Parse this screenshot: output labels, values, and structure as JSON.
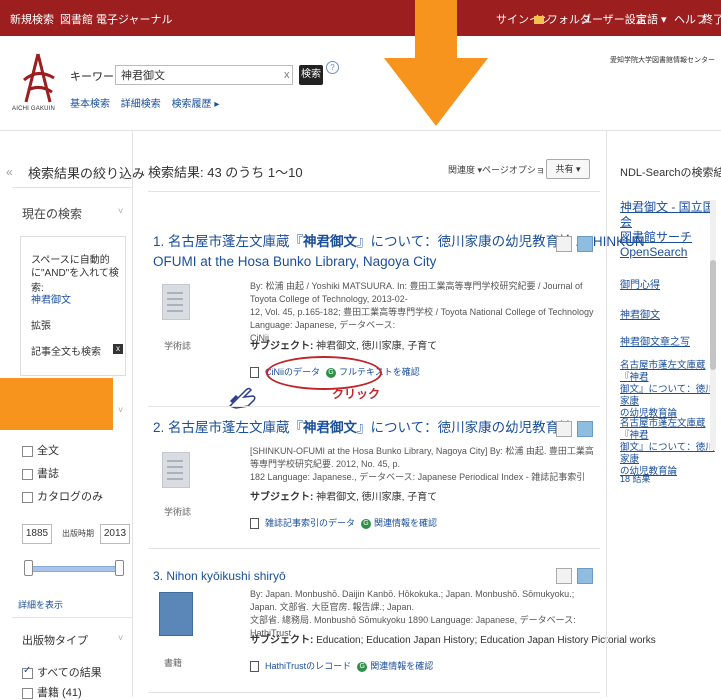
{
  "topbar": {
    "nav": [
      "新規検索",
      "図書館",
      "電子ジャーナル"
    ],
    "right": [
      "サインイン",
      "フォルダ",
      "ユーザー設定",
      "言語 ▾",
      "ヘルプ",
      "終了"
    ]
  },
  "header": {
    "logo_text": "AICHI GAKUIN",
    "search_type": "キーワード ▾",
    "search_value": "神君御文",
    "search_button": "検索",
    "help": "?",
    "sublinks": [
      "基本検索",
      "詳細検索",
      "検索履歴 ▸"
    ],
    "institution": "愛知学院大学図書館情報センター"
  },
  "sidebar": {
    "filter_title": "検索結果の絞り込み",
    "current_search": "現在の検索",
    "box": {
      "hint_line1": "スペースに自動的",
      "hint_line2": "に\"AND\"を入れて検索:",
      "term": "神君御文",
      "expand": "拡張",
      "fulltext_search": "記事全文も検索",
      "remove": "x"
    },
    "checkboxes": [
      "全文",
      "書誌",
      "カタログのみ"
    ],
    "year_from": "1885",
    "year_label": "出版時期",
    "year_to": "2013",
    "show_detail": "詳細を表示",
    "pub_type": "出版物タイプ",
    "pub_types": [
      "すべての結果",
      "書籍 (41)"
    ]
  },
  "results": {
    "count": "検索結果: 43 のうち 1〜10",
    "sort": "関連度 ▾",
    "page_options": "ページオプション ▾",
    "share": "共有 ▾",
    "items": [
      {
        "num_title_1": "1. 名古屋市蓬左文庫蔵『",
        "bold": "神君御文",
        "num_title_2": "』について：徳川家康の幼児教育論 / SHINKUN-",
        "title_line2": "OFUMI at the Hosa Bunko Library, Nagoya City",
        "meta_1": "By: 松浦 由起 / Yoshiki MATSUURA. In: 豊田工業高等専門学校研究紀要 / Journal of Toyota College of Technology, 2013-02-",
        "meta_2": "12, Vol. 45, p.165-182; 豊田工業高等専門学校 / Toyota National College of Technology Language: Japanese, データベース:",
        "meta_3": "CiNii",
        "type": "学術誌",
        "subject_label": "サブジェクト:",
        "subject": "神君御文, 徳川家康, 子育て",
        "link1": "CiNiiのデータ",
        "link2": "フルテキストを確認"
      },
      {
        "num_title_1": "2. 名古屋市蓬左文庫蔵『",
        "bold": "神君御文",
        "num_title_2": "』について：徳川家康の幼児教育論",
        "meta_1": "[SHINKUN-OFUMI at the Hosa Bunko Library, Nagoya City] By: 松浦 由起. 豊田工業高等専門学校研究紀要. 2012, No. 45, p.",
        "meta_2": "182 Language: Japanese., データベース: Japanese Periodical Index - 雑誌記事索引",
        "type": "学術誌",
        "subject_label": "サブジェクト:",
        "subject": "神君御文, 徳川家康, 子育て",
        "link1": "雑誌記事索引のデータ",
        "link2": "関連情報を確認"
      },
      {
        "title": "3. Nihon kyōikushi shiryō",
        "meta_1": "By: Japan. Monbushō. Daijin Kanbō. Hōkokuka.; Japan. Monbushō. Sōmukyoku.; Japan. 文部省. 大臣官房. 報告課.; Japan.",
        "meta_2": "文部省. 總務局. Monbushō Sōmukyoku 1890 Language: Japanese, データベース: HathiTrust",
        "type": "書籍",
        "subject_label": "サブジェクト:",
        "subject": "Education; Education Japan History; Education Japan History Pictorial works",
        "link1": "HathiTrustのレコード",
        "link2": "関連情報を確認"
      }
    ]
  },
  "annotation": {
    "click_label": "クリック"
  },
  "right_panel": {
    "title": "NDL-Searchの検索結果 ▾",
    "links": [
      [
        "神君御文 - 国立国会",
        "図書館サーチ",
        "OpenSearch"
      ],
      [
        "御門心得"
      ],
      [
        "神君御文"
      ],
      [
        "神君御文章之写"
      ],
      [
        "名古屋市蓬左文庫蔵『神君",
        "御文』について：徳川家康",
        "の幼児教育論"
      ],
      [
        "名古屋市蓬左文庫蔵『神君",
        "御文』について：徳川家康",
        "の幼児教育論"
      ]
    ],
    "more": "18 結果"
  },
  "colors": {
    "topbar": "#9c1e1e",
    "accent_orange": "#f7941d",
    "link": "#1a4f9c",
    "annotation_red": "#c0252a"
  }
}
